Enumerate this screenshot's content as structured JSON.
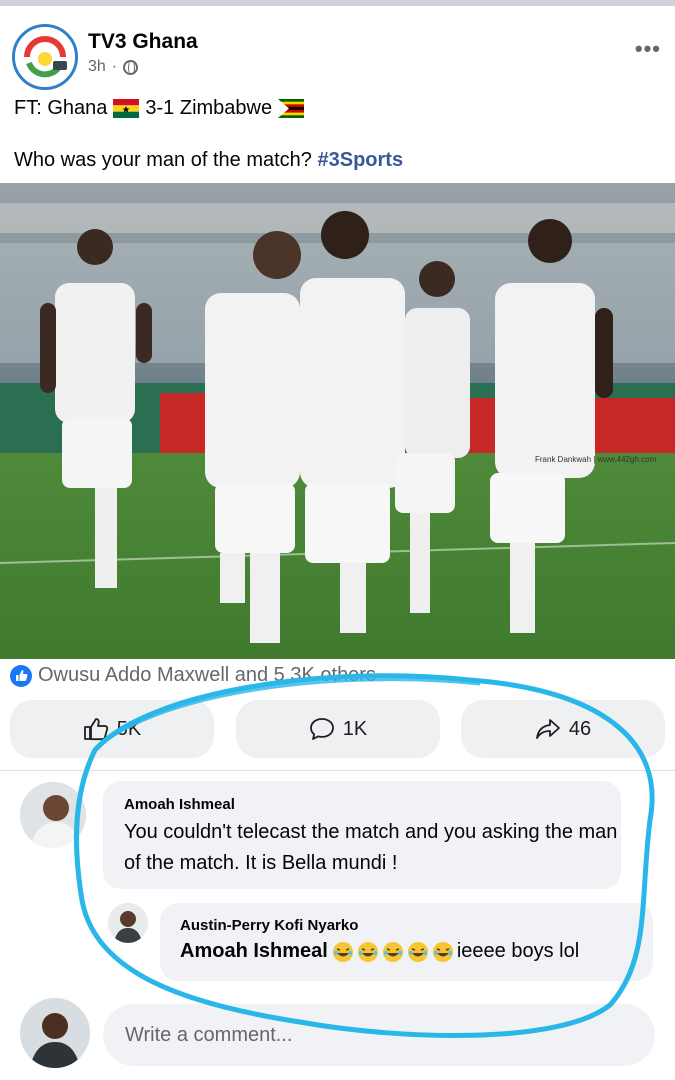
{
  "post": {
    "page_name": "TV3 Ghana",
    "time": "3h",
    "separator": "·",
    "score_prefix": "FT: Ghana",
    "score_mid": "3-1 Zimbabwe",
    "question": "Who was your man of the match?",
    "hashtag": "#3Sports",
    "photo_watermark": "Frank Dankwah | www.442gh.com"
  },
  "reactions": {
    "summary": "Owusu Addo Maxwell and 5.3K others"
  },
  "actions": {
    "like_count": "5K",
    "comment_count": "1K",
    "share_count": "46"
  },
  "comments": [
    {
      "author": "Amoah Ishmeal",
      "text": "You couldn't telecast the match and you asking the man of the match. It is Bella mundi !"
    }
  ],
  "replies": [
    {
      "author": "Austin-Perry Kofi Nyarko",
      "mention": "Amoah Ishmeal",
      "text": "ieeee boys lol"
    }
  ],
  "composer": {
    "placeholder": "Write a comment..."
  },
  "colors": {
    "facebook_blue": "#1877f2",
    "annotation": "#29b6e8"
  }
}
